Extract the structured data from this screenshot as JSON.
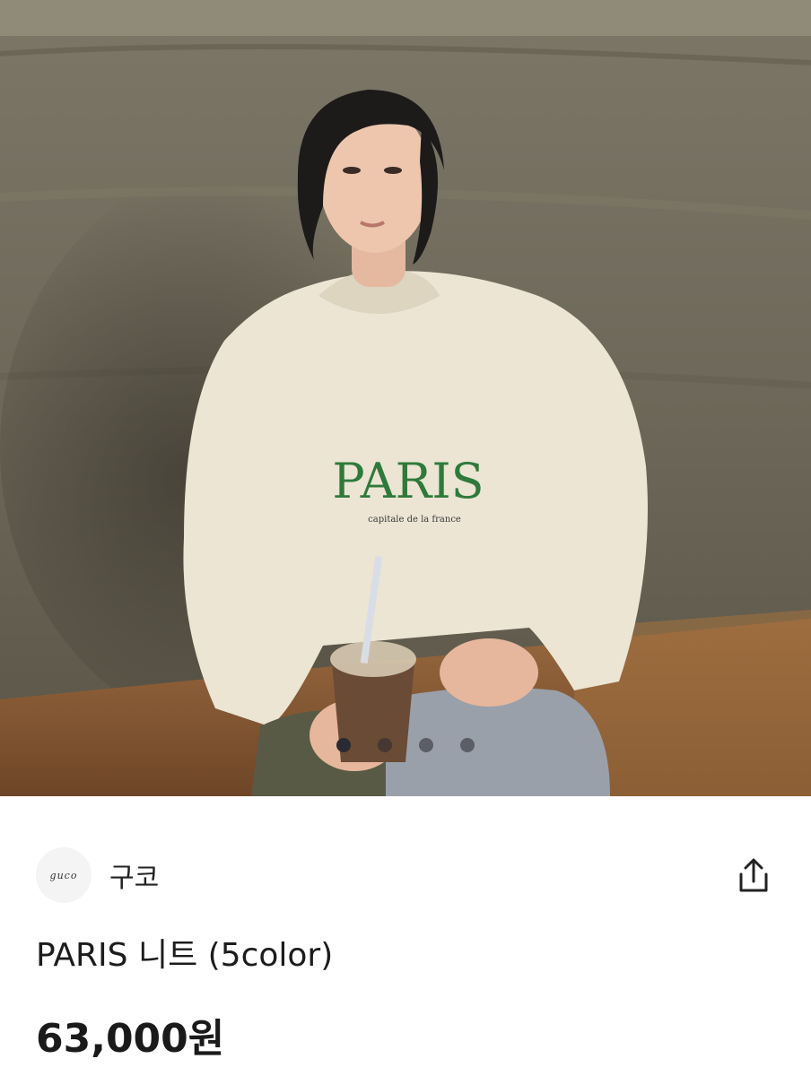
{
  "seller": {
    "logo_text": "guco",
    "name": "구코"
  },
  "product": {
    "name": "PARIS 니트 (5color)",
    "price": "63,000원",
    "photo_print_title": "PARIS",
    "photo_print_subtitle": "capitale de la france"
  },
  "carousel": {
    "total": 4,
    "active_index": 0
  },
  "icons": {
    "share": "share-icon"
  },
  "colors": {
    "wall": "#6f6a5c",
    "floor": "#8a5e3a",
    "sweater": "#ece5d4",
    "print": "#2f7a3a",
    "jeans": "#9aa0aa",
    "text": "#1c1c1c"
  }
}
